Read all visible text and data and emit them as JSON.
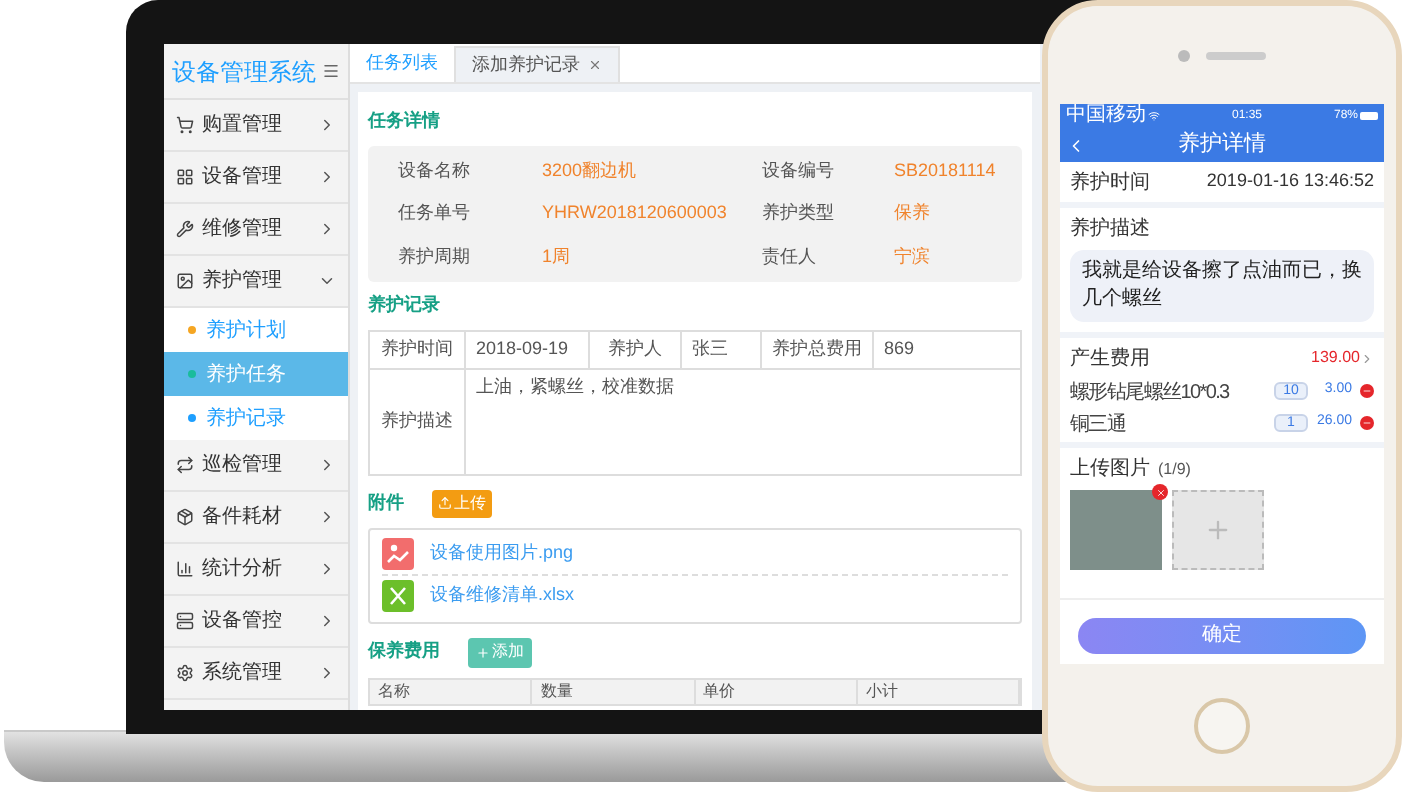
{
  "sidebar": {
    "title": "设备管理系统",
    "items": [
      {
        "label": "购置管理",
        "expanded": false
      },
      {
        "label": "设备管理",
        "expanded": false
      },
      {
        "label": "维修管理",
        "expanded": false
      },
      {
        "label": "养护管理",
        "expanded": true,
        "children": [
          {
            "label": "养护计划",
            "selected": false,
            "color": "#f5a623"
          },
          {
            "label": "养护任务",
            "selected": true,
            "color": "#1abc9c"
          },
          {
            "label": "养护记录",
            "selected": false,
            "color": "#1e9fff"
          }
        ]
      },
      {
        "label": "巡检管理",
        "expanded": false
      },
      {
        "label": "备件耗材",
        "expanded": false
      },
      {
        "label": "统计分析",
        "expanded": false
      },
      {
        "label": "设备管控",
        "expanded": false
      },
      {
        "label": "系统管理",
        "expanded": false
      }
    ]
  },
  "tabs": [
    {
      "label": "任务列表",
      "selected": false,
      "closable": false
    },
    {
      "label": "添加养护记录",
      "selected": true,
      "closable": true
    }
  ],
  "task_details": {
    "title": "任务详情",
    "fields": [
      {
        "label": "设备名称",
        "value": "3200翻边机"
      },
      {
        "label": "设备编号",
        "value": "SB20181114"
      },
      {
        "label": "任务单号",
        "value": "YHRW2018120600003"
      },
      {
        "label": "养护类型",
        "value": "保养"
      },
      {
        "label": "养护周期",
        "value": "1周"
      },
      {
        "label": "责任人",
        "value": "宁滨"
      }
    ]
  },
  "maintenance_record": {
    "title": "养护记录",
    "cells": [
      {
        "label": "养护时间",
        "value": "2018-09-19"
      },
      {
        "label": "养护人",
        "value": "张三"
      },
      {
        "label": "养护总费用",
        "value": "869"
      }
    ],
    "description": {
      "label": "养护描述",
      "value": "上油，紧螺丝，校准数据"
    }
  },
  "attachments": {
    "title": "附件",
    "upload_button": "上传",
    "files": [
      {
        "name": "设备使用图片.png",
        "kind": "image"
      },
      {
        "name": "设备维修清单.xlsx",
        "kind": "sheet"
      }
    ]
  },
  "costs": {
    "title": "保养费用",
    "add_button": "添加",
    "columns": [
      "名称",
      "数量",
      "单价",
      "小计"
    ]
  },
  "phone": {
    "status_bar": {
      "carrier": "中国移动",
      "time": "01:35",
      "battery": "78%"
    },
    "title": "养护详情",
    "time_label": "养护时间",
    "time_value": "2019-01-16 13:46:52",
    "description_label": "养护描述",
    "description": "我就是给设备擦了点油而已，换几个螺丝",
    "cost_label": "产生费用",
    "cost_total": "139.00",
    "cost_items": [
      {
        "name": "螺形钻尾螺丝10*0.3",
        "quantity": "10",
        "price": "3.00"
      },
      {
        "name": "铜三通",
        "quantity": "1",
        "price": "26.00"
      }
    ],
    "upload_label": "上传图片",
    "upload_count": "(1/9)",
    "confirm_button": "确定"
  }
}
